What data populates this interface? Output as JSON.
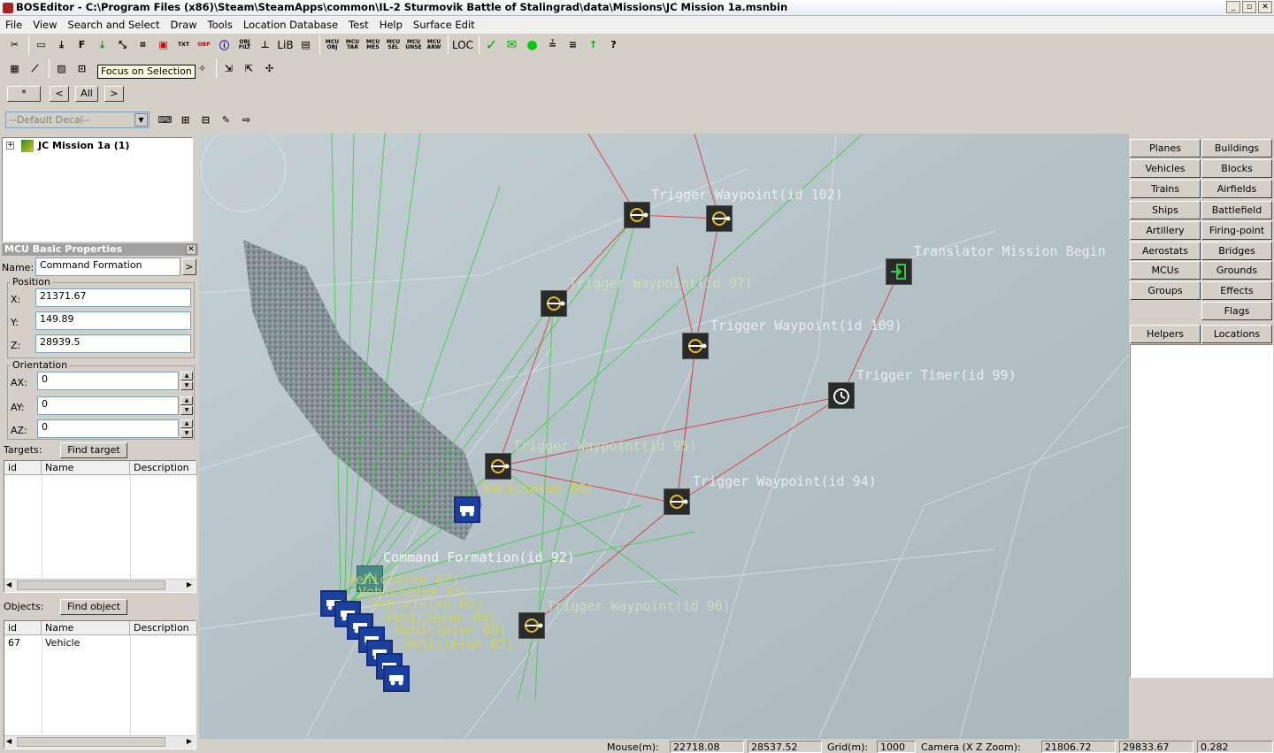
{
  "window": {
    "title": "BOSEditor - C:\\Program Files (x86)\\Steam\\SteamApps\\common\\IL-2 Sturmovik Battle of Stalingrad\\data\\Missions\\JC Mission 1a.msnbin"
  },
  "menu": [
    "File",
    "View",
    "Search and Select",
    "Draw",
    "Tools",
    "Location Database",
    "Test",
    "Help",
    "Surface Edit"
  ],
  "toolbar1": {
    "mcu_buttons": [
      "MCU OBJ",
      "MCU TAR",
      "MCU MES",
      "MCU SEL",
      "MCU UNSE",
      "MCU ARW"
    ],
    "lib": "LiB",
    "loc": "LOC",
    "obj_filt": "OBJ FILT",
    "txt": "TXT",
    "obp": "OBP"
  },
  "tooltip": "Focus on Selection",
  "nav": {
    "star": "*",
    "prev": "<",
    "all": "All",
    "next": ">"
  },
  "decal": {
    "value": "--Default Decal--"
  },
  "tree": {
    "root": "JC Mission 1a (1)"
  },
  "props": {
    "title": "MCU Basic Properties",
    "name_label": "Name:",
    "name_value": "Command Formation",
    "position_label": "Position",
    "x_label": "X:",
    "x_value": "21371.67",
    "y_label": "Y:",
    "y_value": "149.89",
    "z_label": "Z:",
    "z_value": "28939.5",
    "orientation_label": "Orientation",
    "ax_label": "AX:",
    "ax_value": "0",
    "ay_label": "AY:",
    "ay_value": "0",
    "az_label": "AZ:",
    "az_value": "0",
    "targets_label": "Targets:",
    "find_target": "Find target",
    "objects_label": "Objects:",
    "find_object": "Find object",
    "col_id": "id",
    "col_name": "Name",
    "col_desc": "Description",
    "objects_rows": [
      {
        "id": "67",
        "name": "Vehicle",
        "desc": ""
      }
    ]
  },
  "map_labels": [
    "Trigger Waypoint(id 102)",
    "Trigger Waypoint(id 97)",
    "Translator Mission Begin",
    "Trigger Waypoint(id 109)",
    "Trigger Timer(id 99)",
    "Trigger Waypoint(id 95)",
    "Vehicle(en 88)",
    "Trigger Waypoint(id 94)",
    "Command Formation(id 92)",
    "Trigger Waypoint(id 90)",
    "Vehicle(en 67)",
    "Vehicle(en 85)",
    "Vehicle(en 83)",
    "Vehicle(en 86)",
    "Vehicle(en 89)",
    "Vehicle(en 87)"
  ],
  "right_panel": {
    "buttons": [
      "Planes",
      "Buildings",
      "Vehicles",
      "Blocks",
      "Trains",
      "Airfields",
      "Ships",
      "Battlefield",
      "Artillery",
      "Firing-point",
      "Aerostats",
      "Bridges",
      "MCUs",
      "Grounds",
      "Groups",
      "Effects",
      "Flags"
    ],
    "helpers": "Helpers",
    "locations": "Locations"
  },
  "status": {
    "mouse_label": "Mouse(m):",
    "mouse_x": "22718.08",
    "mouse_z": "28537.52",
    "grid_label": "Grid(m):",
    "grid": "1000",
    "camera_label": "Camera (X Z Zoom):",
    "cam_x": "21806.72",
    "cam_z": "29833.67",
    "zoom": "0.282"
  },
  "colors": {
    "map_bg": "#b8c6cc",
    "green_line": "#3ccf3c",
    "red_line": "#e03030",
    "label_green": "#c8e6b4",
    "label_yellow": "#d8d840",
    "label_white": "#f4f4f4"
  }
}
